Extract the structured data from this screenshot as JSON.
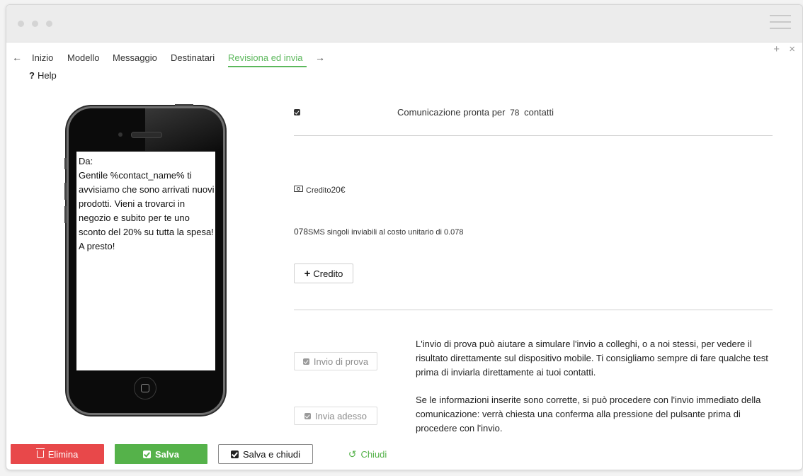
{
  "window": {
    "title_dots": [
      "close",
      "minimize",
      "maximize"
    ],
    "menu_icon": "hamburger-icon",
    "add_label": "+",
    "close_label": "×"
  },
  "nav": {
    "back_arrow": "←",
    "forward_arrow": "→",
    "items": [
      "Inizio",
      "Modello",
      "Messaggio",
      "Destinatari",
      "Revisiona ed invia"
    ],
    "active_index": 4
  },
  "help": {
    "icon": "?",
    "label": "Help"
  },
  "preview": {
    "from_label": "Da:",
    "message": "Gentile %contact_name% ti avvisiamo che sono arrivati nuovi prodotti. Vieni a trovarci in negozio e subito per te uno sconto del 20% su tutta la spesa! A presto!"
  },
  "summary": {
    "ready_prefix": "Comunicazione pronta per",
    "contacts_count": "78",
    "ready_suffix": "contatti",
    "credit_label": "Credito",
    "credit_value": "20€",
    "sms_count": "078",
    "sms_text": "SMS singoli inviabili al costo unitario di 0.078",
    "add_credit_label": "Credito"
  },
  "actions": {
    "test_button": "Invio di prova",
    "test_description": "L'invio di prova può aiutare a simulare l'invio a colleghi, o a noi stessi, per vedere il risultato direttamente sul dispositivo mobile. Ti consigliamo sempre di fare qualche test prima di inviarla direttamente ai tuoi contatti.",
    "send_button": "Invia adesso",
    "send_description": "Se le informazioni inserite sono corrette, si può procedere con l'invio immediato della comunicazione: verrà chiesta una conferma alla pressione del pulsante prima di procedere con l'invio."
  },
  "footer": {
    "delete_label": "Elimina",
    "save_label": "Salva",
    "save_close_label": "Salva e chiudi",
    "close_label": "Chiudi"
  },
  "colors": {
    "accent_green": "#55b24a",
    "danger_red": "#e8484a",
    "nav_active": "#5cb85c"
  }
}
